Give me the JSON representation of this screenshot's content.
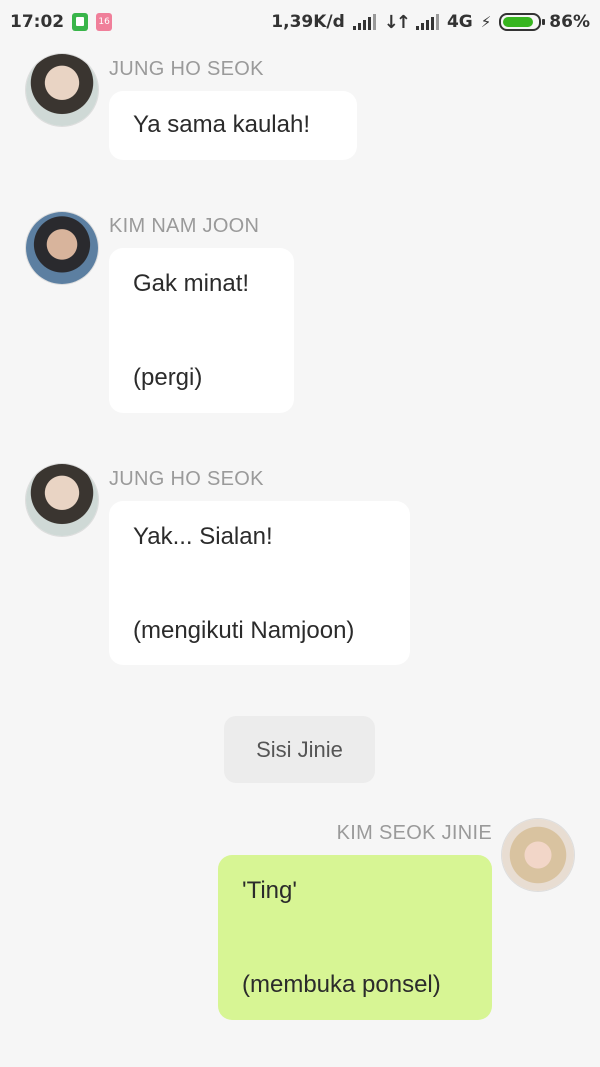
{
  "status_bar": {
    "time": "17:02",
    "calendar_badge": "16",
    "network_speed": "1,39K/d",
    "network_type": "4G",
    "battery_percent": "86%",
    "battery_level": 0.86
  },
  "messages": [
    {
      "sender": "JUNG HO SEOK",
      "line1": "Ya sama kaulah!",
      "line2": ""
    },
    {
      "sender": "KIM NAM JOON",
      "line1": "Gak minat!",
      "line2": "(pergi)"
    },
    {
      "sender": "JUNG HO SEOK",
      "line1": "Yak... Sialan!",
      "line2": "(mengikuti Namjoon)"
    }
  ],
  "center_note": "Sisi Jinie",
  "my_message": {
    "sender": "KIM SEOK JINIE",
    "line1": "'Ting'",
    "line2": "(membuka ponsel)"
  },
  "colors": {
    "background": "#f6f6f6",
    "my_bubble": "#d7f594",
    "other_bubble": "#ffffff"
  }
}
